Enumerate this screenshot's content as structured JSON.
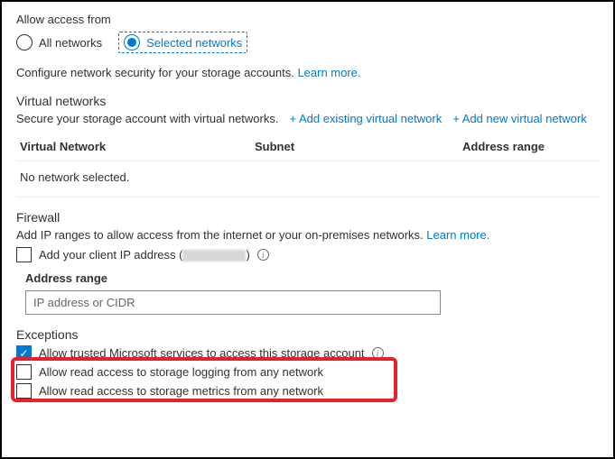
{
  "access": {
    "title": "Allow access from",
    "options": {
      "all": "All networks",
      "selected": "Selected networks"
    }
  },
  "desc": {
    "text": "Configure network security for your storage accounts. ",
    "link": "Learn more."
  },
  "vnet": {
    "heading": "Virtual networks",
    "desc": "Secure your storage account with virtual networks.",
    "add_existing": "+ Add existing virtual network",
    "add_new": "+ Add new virtual network",
    "cols": {
      "name": "Virtual Network",
      "subnet": "Subnet",
      "range": "Address range"
    },
    "empty": "No network selected."
  },
  "firewall": {
    "heading": "Firewall",
    "desc": "Add IP ranges to allow access from the internet or your on-premises networks. ",
    "link": "Learn more.",
    "add_client_prefix": "Add your client IP address (",
    "add_client_suffix": ")",
    "field_label": "Address range",
    "placeholder": "IP address or CIDR"
  },
  "exceptions": {
    "heading": "Exceptions",
    "trusted": "Allow trusted Microsoft services to access this storage account",
    "logging": "Allow read access to storage logging from any network",
    "metrics": "Allow read access to storage metrics from any network"
  }
}
